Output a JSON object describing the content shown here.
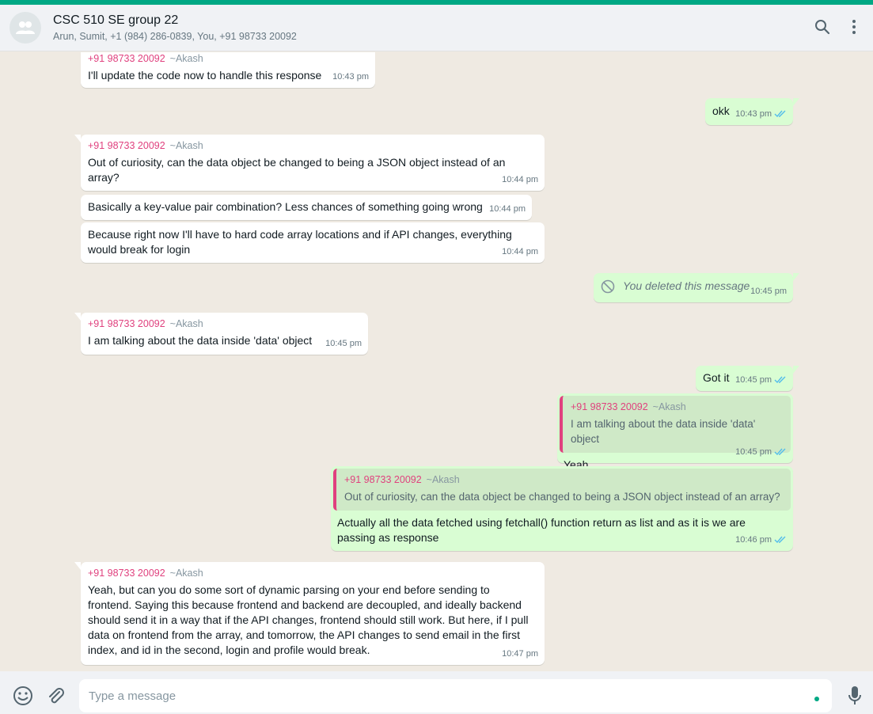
{
  "header": {
    "title": "CSC 510 SE group 22",
    "subtitle": "Arun, Sumit, +1 (984) 286-0839, You, +91 98733 20092"
  },
  "messages": [
    {
      "sender": "+91 98733 20092",
      "alias": "~Akash",
      "text": "I'll update the code now to handle this response",
      "time": "10:43 pm"
    },
    {
      "text": "okk",
      "time": "10:43 pm"
    },
    {
      "sender": "+91 98733 20092",
      "alias": "~Akash",
      "text": "Out of curiosity, can the data object be changed to being a JSON object instead of an array?",
      "time": "10:44 pm"
    },
    {
      "text": "Basically a key-value pair combination? Less chances of something going wrong",
      "time": "10:44 pm"
    },
    {
      "text": "Because right now I'll have to hard code array locations and if API changes, everything would break for login",
      "time": "10:44 pm"
    },
    {
      "text": "You deleted this message",
      "time": "10:45 pm"
    },
    {
      "sender": "+91 98733 20092",
      "alias": "~Akash",
      "text": "I am talking about the data inside 'data' object",
      "time": "10:45 pm"
    },
    {
      "text": "Got it",
      "time": "10:45 pm"
    },
    {
      "quote_sender": "+91 98733 20092",
      "quote_alias": "~Akash",
      "quote_text": "I am talking about the data inside 'data' object",
      "text": "Yeah",
      "time": "10:45 pm"
    },
    {
      "quote_sender": "+91 98733 20092",
      "quote_alias": "~Akash",
      "quote_text": "Out of curiosity, can the data object be changed to being a JSON object instead of an array?",
      "text": "Actually all the data fetched using fetchall() function return as list and as it is we are passing as response",
      "time": "10:46 pm"
    },
    {
      "sender": "+91 98733 20092",
      "alias": "~Akash",
      "text": "Yeah, but can you do some sort of dynamic parsing on your end before sending to frontend. Saying this because frontend and backend are decoupled, and ideally backend should send it in a way that if the API changes, frontend should still work. But here, if I pull data on frontend from the array, and tomorrow, the API changes to send email in the first index, and id in the second, login and profile would break.",
      "time": "10:47 pm"
    }
  ],
  "composer": {
    "placeholder": "Type a message"
  },
  "colors": {
    "accent": "#00a884",
    "outgoing": "#d9fdd3",
    "incoming": "#ffffff",
    "sender": "#e0417e",
    "tick": "#53bdeb"
  }
}
